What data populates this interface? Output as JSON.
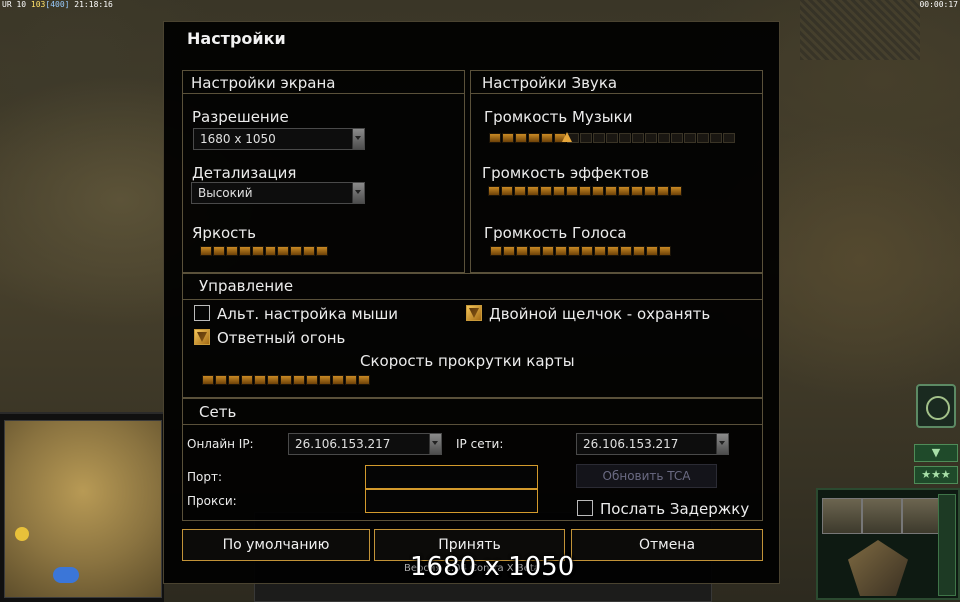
{
  "hud": {
    "fps_label": "UR 10",
    "fps_value": "103",
    "fps_extra": "[400]",
    "clock": "21:18:16",
    "timer": "00:00:17"
  },
  "window": {
    "title": "Настройки"
  },
  "display": {
    "header": "Настройки экрана",
    "resolution_label": "Разрешение",
    "resolution_value": "1680 x 1050",
    "detail_label": "Детализация",
    "detail_value": "Высокий",
    "brightness_label": "Яркость",
    "brightness_level": 1.0
  },
  "sound": {
    "header": "Настройки Звука",
    "music_label": "Громкость Музыки",
    "music_level": 0.32,
    "effects_label": "Громкость эффектов",
    "effects_level": 1.0,
    "voice_label": "Громкость Голоса",
    "voice_level": 1.0
  },
  "controls": {
    "header": "Управление",
    "alt_mouse_label": "Альт. настройка мыши",
    "alt_mouse_checked": false,
    "double_click_label": "Двойной щелчок - охранять",
    "double_click_checked": true,
    "retaliation_label": "Ответный огонь",
    "retaliation_checked": true,
    "scroll_speed_label": "Скорость прокрутки карты",
    "scroll_speed_level": 1.0
  },
  "network": {
    "header": "Сеть",
    "online_ip_label": "Онлайн IP:",
    "online_ip_value": "26.106.153.217",
    "lan_ip_label": "IP сети:",
    "lan_ip_value": "26.106.153.217",
    "port_label": "Порт:",
    "port_value": "",
    "proxy_label": "Прокси:",
    "proxy_value": "",
    "update_tca_label": "Обновить TCA",
    "send_delay_label": "Послать Задержку",
    "send_delay_checked": false
  },
  "buttons": {
    "defaults": "По умолчанию",
    "accept": "Принять",
    "cancel": "Отмена"
  },
  "footer": {
    "version_text": "Версия 1.04 Contra X Beta",
    "overlay_text": "1680 x 1050"
  },
  "command_bar": {
    "tab_down": "▼",
    "tab_stars": "★★★"
  },
  "colors": {
    "accent": "#c29338",
    "slider_fill": "#c98a24",
    "panel_border": "#5a513a"
  }
}
